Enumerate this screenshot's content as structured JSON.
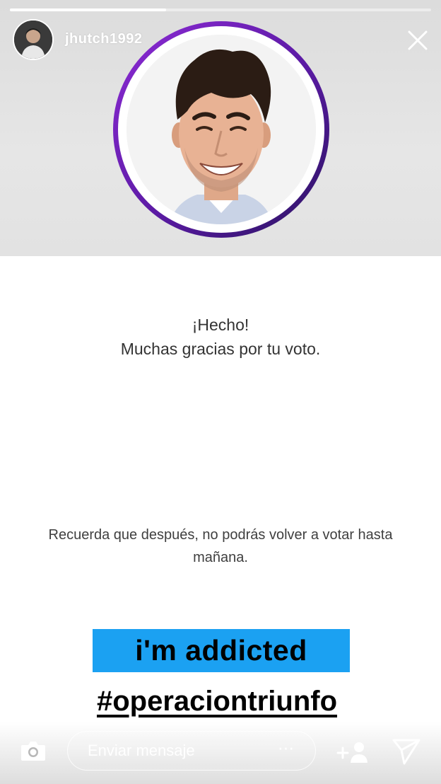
{
  "story": {
    "username": "jhutch1992",
    "progress": 0.37
  },
  "poll_result": {
    "line1": "¡Hecho!",
    "line2": "Muchas gracias por tu voto."
  },
  "reminder": {
    "text": "Recuerda que después, no podrás volver a votar hasta mañana."
  },
  "stickers": {
    "addicted": "i'm addicted",
    "hashtag": "#operaciontriunfo"
  },
  "reply_bar": {
    "placeholder": "Enviar mensaje",
    "more": "···"
  },
  "icons": {
    "close": "close-icon",
    "camera": "camera-icon",
    "add_user": "add-user-icon",
    "send": "send-icon"
  },
  "colors": {
    "sticker_bg": "#1ba1f2",
    "ring_start": "#8e2bd6",
    "ring_end": "#2a1460"
  }
}
